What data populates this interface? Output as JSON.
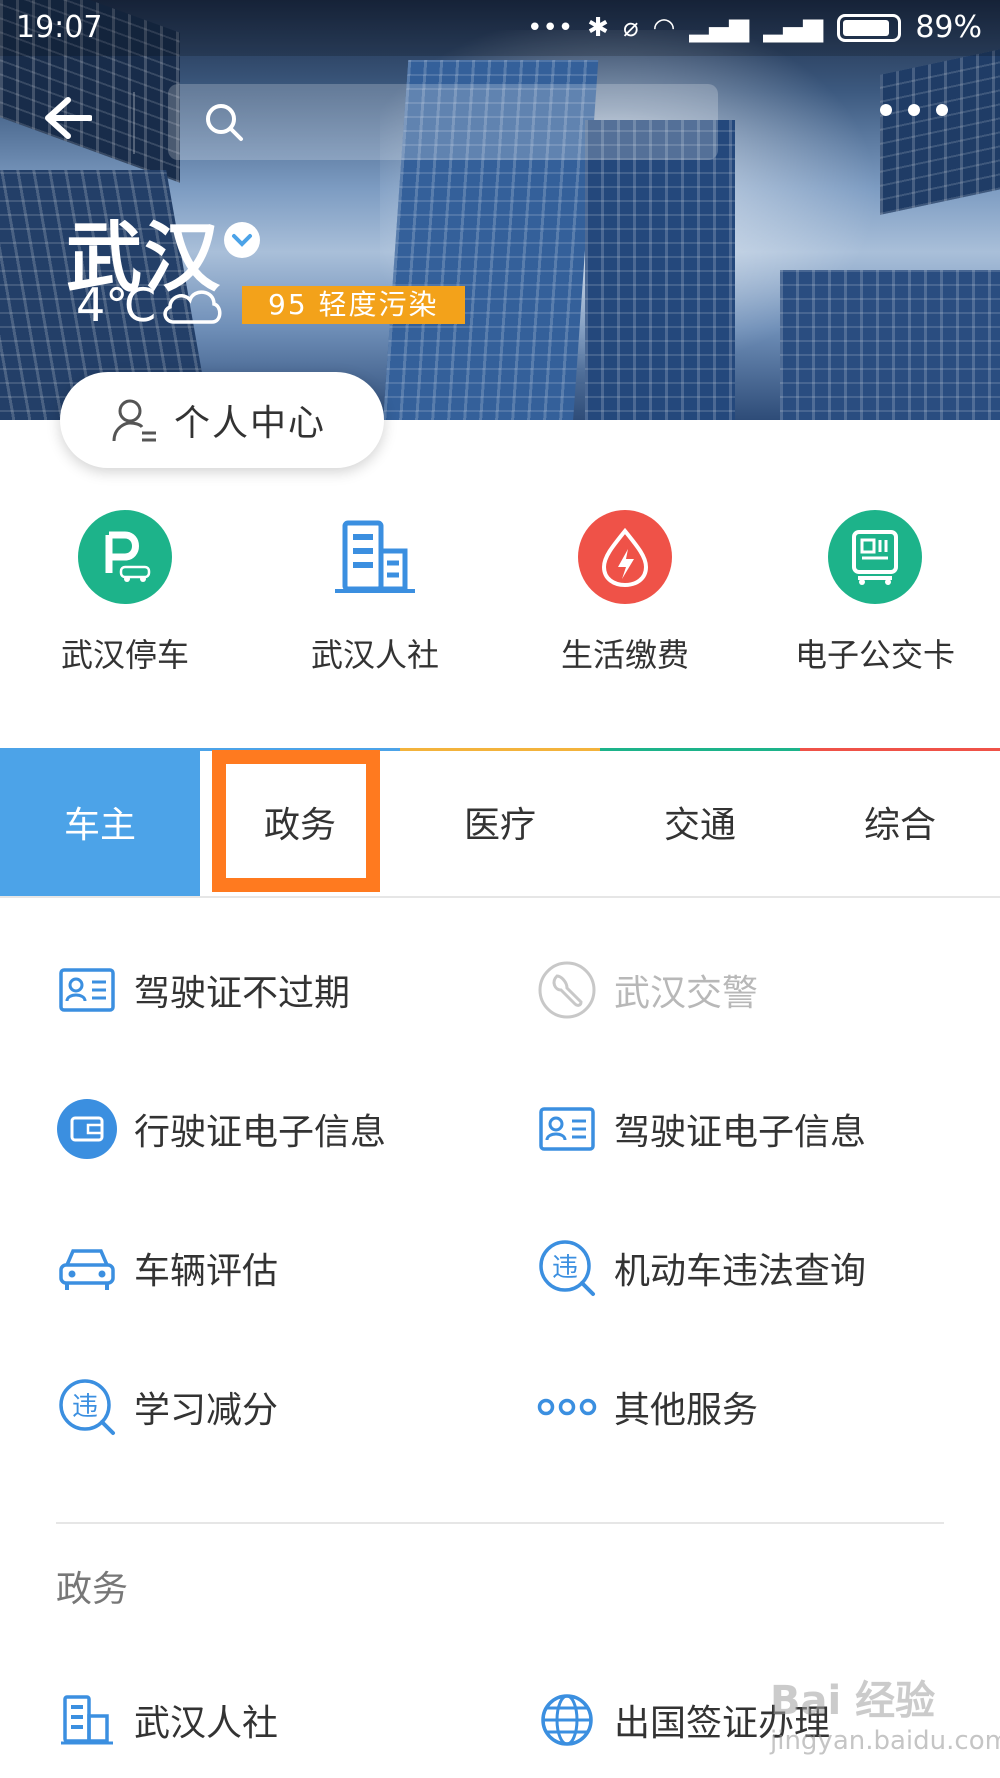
{
  "status_bar": {
    "time": "19:07",
    "battery": "89%"
  },
  "header": {
    "search_placeholder": "",
    "city": "武汉",
    "temperature": "4℃",
    "aqi": "95 轻度污染",
    "personal_center": "个人中心"
  },
  "quick_services": [
    {
      "label": "武汉停车",
      "icon": "parking-icon",
      "color": "#1db38a"
    },
    {
      "label": "武汉人社",
      "icon": "building-icon",
      "color": "#3b8fe0"
    },
    {
      "label": "生活缴费",
      "icon": "energy-icon",
      "color": "#ef5248"
    },
    {
      "label": "电子公交卡",
      "icon": "bus-card-icon",
      "color": "#1db38a"
    }
  ],
  "tabs": [
    {
      "label": "车主",
      "active": true,
      "line_color": "#4ca3e8"
    },
    {
      "label": "政务",
      "active": false,
      "line_color": "#4ca3e8"
    },
    {
      "label": "医疗",
      "active": false,
      "line_color": "#f3b33c"
    },
    {
      "label": "交通",
      "active": false,
      "line_color": "#1db38a"
    },
    {
      "label": "综合",
      "active": false,
      "line_color": "#ef5248"
    }
  ],
  "services": [
    {
      "label": "驾驶证不过期",
      "icon": "license-card-icon",
      "disabled": false
    },
    {
      "label": "武汉交警",
      "icon": "wrench-icon",
      "disabled": true
    },
    {
      "label": "行驶证电子信息",
      "icon": "wallet-card-icon",
      "disabled": false
    },
    {
      "label": "驾驶证电子信息",
      "icon": "license-card-icon",
      "disabled": false
    },
    {
      "label": "车辆评估",
      "icon": "car-icon",
      "disabled": false
    },
    {
      "label": "机动车违法查询",
      "icon": "violation-icon",
      "disabled": false
    },
    {
      "label": "学习减分",
      "icon": "violation-icon",
      "disabled": false
    },
    {
      "label": "其他服务",
      "icon": "more-dots-icon",
      "disabled": false
    }
  ],
  "section": {
    "title": "政务",
    "items": [
      {
        "label": "武汉人社",
        "icon": "building-icon"
      },
      {
        "label": "出国签证办理",
        "icon": "globe-icon"
      }
    ]
  },
  "accent_color": "#4ca3e8",
  "highlight_color": "#ff7a1f",
  "watermark": {
    "brand": "Bai 经验",
    "url": "jingyan.baidu.com"
  }
}
